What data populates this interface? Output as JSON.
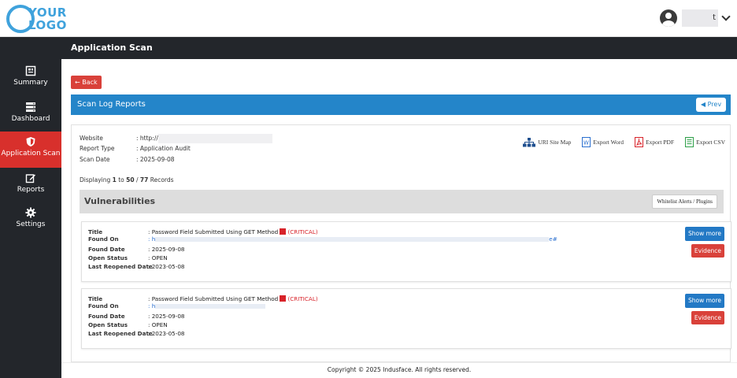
{
  "header": {
    "logo_line1": "YOUR",
    "logo_line2": "LOGO",
    "user_name": "t",
    "brand_color": "#3fa2dc"
  },
  "sidebar": {
    "items": [
      {
        "label": "Summary",
        "icon": "summary-icon"
      },
      {
        "label": "Dashboard",
        "icon": "dashboard-icon"
      },
      {
        "label": "Application Scan",
        "icon": "shield-icon",
        "active": true
      },
      {
        "label": "Reports",
        "icon": "edit-icon"
      },
      {
        "label": "Settings",
        "icon": "gear-icon"
      }
    ],
    "active_color": "#d8302c"
  },
  "page": {
    "title": "Application Scan",
    "back_label": "← Back",
    "section_title": "Scan Log Reports",
    "prev_label": "◀ Prev"
  },
  "report": {
    "website_label": "Website",
    "website_value": ": http://",
    "type_label": "Report Type",
    "type_value": ": Application Audit",
    "date_label": "Scan Date",
    "date_value": ": 2025-09-08"
  },
  "exports": {
    "site_map": "URI Site Map",
    "word": "Export Word",
    "pdf": "Export PDF",
    "csv": "Export CSV"
  },
  "records": {
    "prefix": "Displaying ",
    "from": "1",
    "to_word": " to ",
    "to": "50",
    "sep": " / ",
    "total": "77",
    "suffix": " Records"
  },
  "vulnerabilities": {
    "heading": "Vulnerabilities",
    "whitelist_label": "Whitelist Alerts / Plugins",
    "labels": {
      "title": "Title",
      "found_on": "Found On",
      "found_date": "Found Date",
      "open_status": "Open Status",
      "last_reopened": "Last Reopened Date"
    },
    "items": [
      {
        "title": ": Password Field Submitted Using GET Method",
        "severity": "(CRITICAL)",
        "found_on_prefix": ": h",
        "found_on_suffix": "e#",
        "found_date": ": 2025-09-08",
        "open_status": ": OPEN",
        "last_reopened": ": 2023-05-08",
        "show_more": "Show more",
        "evidence": "Evidence"
      },
      {
        "title": ": Password Field Submitted Using GET Method",
        "severity": "(CRITICAL)",
        "found_on_prefix": ": h",
        "found_on_suffix": "",
        "found_date": ": 2025-09-08",
        "open_status": ": OPEN",
        "last_reopened": ": 2023-05-08",
        "show_more": "Show more",
        "evidence": "Evidence"
      }
    ]
  },
  "footer": {
    "copyright": "Copyright © 2025 Indusface. All rights reserved."
  }
}
